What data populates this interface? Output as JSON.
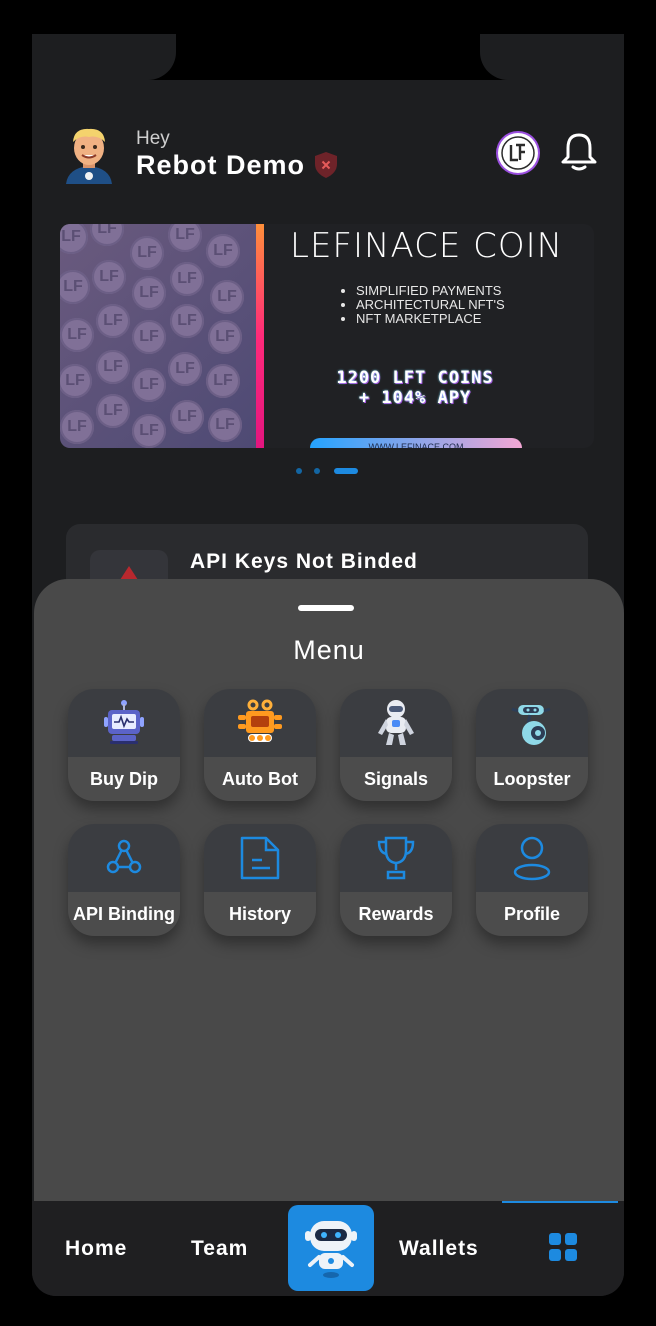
{
  "header": {
    "greeting": "Hey",
    "username": "Rebot Demo",
    "verify_status": "unverified-shield-icon",
    "brand_icon": "lf-logo-icon",
    "notification_icon": "bell-icon"
  },
  "banner": {
    "title": "LEFINACE COIN",
    "bullets": [
      "SIMPLIFIED PAYMENTS",
      "ARCHITECTURAL NFT'S",
      "NFT MARKETPLACE"
    ],
    "promo_line1": "1200 LFT COINS",
    "promo_line2": "+ 104% APY",
    "url": "WWW.LEFINACE.COM",
    "coin_glyph": "LF",
    "carousel_pages": 3,
    "carousel_active": 3
  },
  "api_card": {
    "message": "API Keys Not Binded"
  },
  "menu": {
    "title": "Menu",
    "items": [
      {
        "label": "Buy Dip",
        "icon": "robot-monitor-icon"
      },
      {
        "label": "Auto Bot",
        "icon": "orange-robot-icon"
      },
      {
        "label": "Signals",
        "icon": "astronaut-robot-icon"
      },
      {
        "label": "Loopster",
        "icon": "rolling-robot-icon"
      },
      {
        "label": "API Binding",
        "icon": "nodes-icon"
      },
      {
        "label": "History",
        "icon": "document-icon"
      },
      {
        "label": "Rewards",
        "icon": "trophy-icon"
      },
      {
        "label": "Profile",
        "icon": "user-icon"
      }
    ]
  },
  "nav": {
    "home": "Home",
    "team": "Team",
    "center_icon": "robot-assistant-icon",
    "wallets": "Wallets",
    "menu_icon": "grid-icon",
    "active": "menu"
  },
  "colors": {
    "accent": "#1d8ae0",
    "background": "#1d1e20",
    "sheet": "#494949",
    "tile_top": "#3b3d41"
  }
}
